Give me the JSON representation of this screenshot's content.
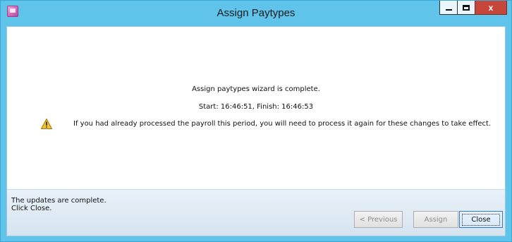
{
  "window": {
    "title": "Assign Paytypes",
    "app_icon": "app-icon",
    "caption_buttons": {
      "minimize_icon": "minimize-icon",
      "maximize_icon": "maximize-icon",
      "close_label": "x"
    }
  },
  "content": {
    "message": "Assign paytypes wizard is complete.",
    "timing": "Start: 16:46:51, Finish: 16:46:53",
    "warning_icon": "warning-icon",
    "warning_text": "If you had already processed the payroll this period, you will need to process it again for these changes to take effect."
  },
  "footer": {
    "status_line1": "The updates are complete.",
    "status_line2": "Click Close.",
    "buttons": {
      "previous": "< Previous",
      "assign": "Assign",
      "close": "Close"
    }
  },
  "colors": {
    "titlebar": "#5fc3ea",
    "close_button": "#c7463a",
    "warning": "#f2c230",
    "focus_border": "#2f7ad1"
  }
}
